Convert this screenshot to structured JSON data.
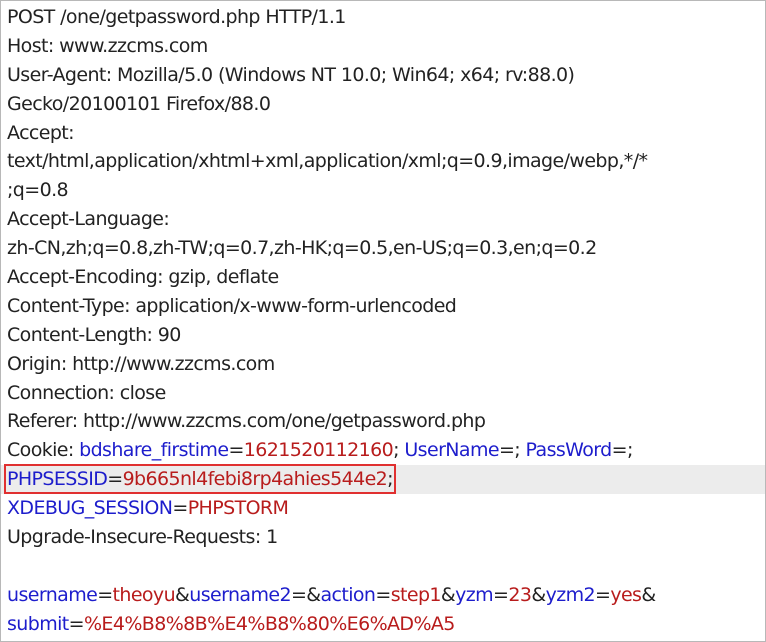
{
  "request_lines": [
    "POST /one/getpassword.php HTTP/1.1",
    "Host: www.zzcms.com",
    "User-Agent: Mozilla/5.0 (Windows NT 10.0; Win64; x64; rv:88.0)",
    "Gecko/20100101 Firefox/88.0",
    "Accept:",
    "text/html,application/xhtml+xml,application/xml;q=0.9,image/webp,*/*",
    ";q=0.8",
    "Accept-Language:",
    "zh-CN,zh;q=0.8,zh-TW;q=0.7,zh-HK;q=0.5,en-US;q=0.3,en;q=0.2",
    "Accept-Encoding: gzip, deflate",
    "Content-Type: application/x-www-form-urlencoded",
    "Content-Length: 90",
    "Origin: http://www.zzcms.com",
    "Connection: close",
    "Referer: http://www.zzcms.com/one/getpassword.php"
  ],
  "cookie": {
    "label": "Cookie: ",
    "name1": "bdshare_firstime",
    "eq": "=",
    "value1": "1621520112160",
    "sep": "; ",
    "name2": "UserName",
    "name3": "PassWord",
    "end": ";",
    "phpsessid_name": "PHPSESSID",
    "phpsessid_value": "9b665nl4febi8rp4ahies544e2",
    "xdebug_name": "XDEBUG_SESSION",
    "xdebug_value": "PHPSTORM"
  },
  "upgrade_line": "Upgrade-Insecure-Requests: 1",
  "body_params": {
    "amp": "&",
    "eq": "=",
    "p1_name": "username",
    "p1_value": "theoyu",
    "p2_name": "username2",
    "p3_name": "action",
    "p3_value": "step1",
    "p4_name": "yzm",
    "p4_value": "23",
    "p5_name": "yzm2",
    "p5_value": "yes",
    "p6_name": "submit",
    "p6_value": "%E4%B8%8B%E4%B8%80%E6%AD%A5"
  },
  "colors": {
    "param_name": "#1d1dcc",
    "param_value": "#b81c1c",
    "highlight_border": "#e03030",
    "highlight_row": "#ececec"
  }
}
